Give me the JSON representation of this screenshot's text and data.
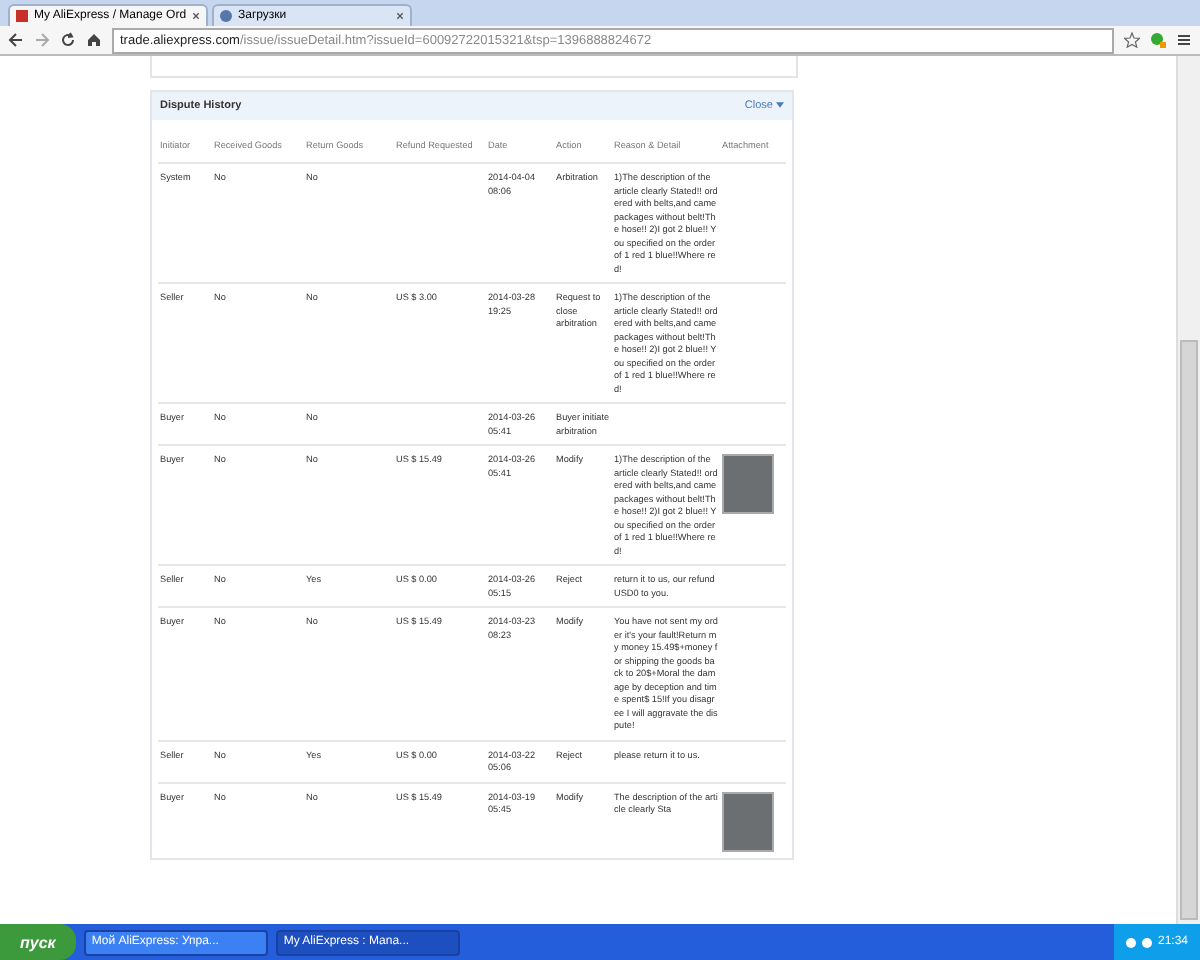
{
  "browser": {
    "tabs": [
      {
        "title": "My AliExpress / Manage Ord",
        "selected": true
      },
      {
        "title": "Загрузки",
        "selected": false
      }
    ],
    "url_host": "trade.aliexpress.com",
    "url_path": "/issue/issueDetail.htm?issueId=60092722015321&tsp=1396888824672"
  },
  "panel": {
    "title": "Dispute History",
    "close_link": "Close",
    "columns": [
      "Initiator",
      "Received Goods",
      "Return Goods",
      "Refund Requested",
      "Date",
      "Action",
      "Reason & Detail",
      "Attachment"
    ],
    "rows": [
      {
        "initiator": "System",
        "received_goods": "No",
        "return_goods": "No",
        "refund": "",
        "date": "2014-04-04 08:06",
        "action": "Arbitration",
        "reason": "1)The description of the article clearly Stated!! ordered with belts,and came packages without belt!The hose!! 2)I got 2 blue!! You specified on the order of 1 red 1 blue!!Where red!",
        "has_attachment": false
      },
      {
        "initiator": "Seller",
        "received_goods": "No",
        "return_goods": "No",
        "refund": "US $ 3.00",
        "date": "2014-03-28 19:25",
        "action": "Request to close arbitration",
        "reason": "1)The description of the article clearly Stated!! ordered with belts,and came packages without belt!The hose!! 2)I got 2 blue!! You specified on the order of 1 red 1 blue!!Where red!",
        "has_attachment": false
      },
      {
        "initiator": "Buyer",
        "received_goods": "No",
        "return_goods": "No",
        "refund": "",
        "date": "2014-03-26 05:41",
        "action": "Buyer initiate arbitration",
        "reason": "",
        "has_attachment": false
      },
      {
        "initiator": "Buyer",
        "received_goods": "No",
        "return_goods": "No",
        "refund": "US $ 15.49",
        "date": "2014-03-26 05:41",
        "action": "Modify",
        "reason": "1)The description of the article clearly Stated!! ordered with belts,and came packages without belt!The hose!! 2)I got 2 blue!! You specified on the order of 1 red 1 blue!!Where red!",
        "has_attachment": true
      },
      {
        "initiator": "Seller",
        "received_goods": "No",
        "return_goods": "Yes",
        "refund": "US $ 0.00",
        "date": "2014-03-26 05:15",
        "action": "Reject",
        "reason": "return it to us, our refund USD0 to you.",
        "has_attachment": false
      },
      {
        "initiator": "Buyer",
        "received_goods": "No",
        "return_goods": "No",
        "refund": "US $ 15.49",
        "date": "2014-03-23 08:23",
        "action": "Modify",
        "reason": "You have not sent my order it's your fault!Return my money 15.49$+money for shipping the goods back to 20$+Moral the damage by deception and time spent$ 15!If you disagree I will aggravate the dispute!",
        "has_attachment": false
      },
      {
        "initiator": "Seller",
        "received_goods": "No",
        "return_goods": "Yes",
        "refund": "US $ 0.00",
        "date": "2014-03-22 05:06",
        "action": "Reject",
        "reason": "please return it to us.",
        "has_attachment": false
      },
      {
        "initiator": "Buyer",
        "received_goods": "No",
        "return_goods": "No",
        "refund": "US $ 15.49",
        "date": "2014-03-19 05:45",
        "action": "Modify",
        "reason": "The description of the article clearly Sta",
        "has_attachment": true
      }
    ]
  },
  "taskbar": {
    "start": "пуск",
    "items": [
      {
        "label": "Мой AliExpress: Упра...",
        "selected": false
      },
      {
        "label": "My AliExpress : Mana...",
        "selected": true
      }
    ],
    "clock": "21:34"
  }
}
